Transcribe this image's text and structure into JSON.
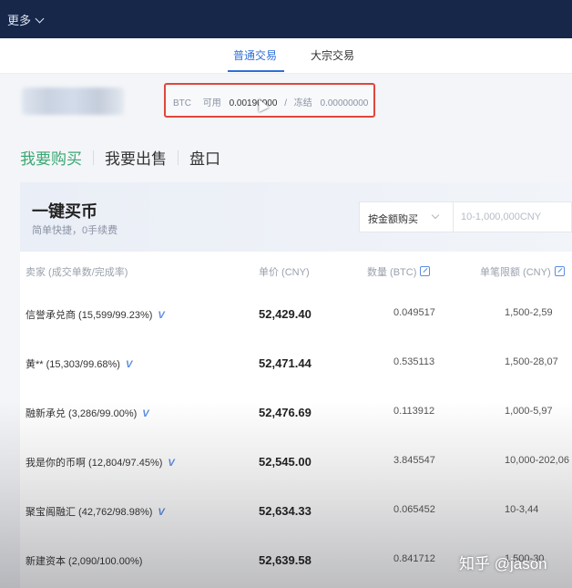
{
  "topbar": {
    "more_label": "更多"
  },
  "trade_tabs": [
    {
      "label": "普通交易",
      "active": true
    },
    {
      "label": "大宗交易",
      "active": false
    }
  ],
  "balance": {
    "coin": "BTC",
    "available_label": "可用",
    "available_value": "0.00190000",
    "separator": "/",
    "frozen_label": "冻结",
    "frozen_value": "0.00000000"
  },
  "mode_tabs": [
    {
      "label": "我要购买",
      "active": true
    },
    {
      "label": "我要出售",
      "active": false
    },
    {
      "label": "盘口",
      "active": false
    }
  ],
  "quick_buy": {
    "title": "一键买币",
    "subtitle": "简单快捷，0手续费",
    "select_value": "按金额购买",
    "input_placeholder": "10-1,000,000CNY"
  },
  "table": {
    "headers": {
      "merchant": "卖家 (成交单数/完成率)",
      "price": "单价 (CNY)",
      "qty": "数量 (BTC)",
      "limit": "单笔限额 (CNY)"
    },
    "rows": [
      {
        "merchant": "信誉承兑商 (15,599/99.23%)",
        "price": "52,429.40",
        "qty": "0.049517",
        "limit": "1,500-2,59"
      },
      {
        "merchant": "黄** (15,303/99.68%)",
        "price": "52,471.44",
        "qty": "0.535113",
        "limit": "1,500-28,07"
      },
      {
        "merchant": "融新承兑 (3,286/99.00%)",
        "price": "52,476.69",
        "qty": "0.113912",
        "limit": "1,000-5,97"
      },
      {
        "merchant": "我是你的币啊 (12,804/97.45%)",
        "price": "52,545.00",
        "qty": "3.845547",
        "limit": "10,000-202,06"
      },
      {
        "merchant": "聚宝阁融汇 (42,762/98.98%)",
        "price": "52,634.33",
        "qty": "0.065452",
        "limit": "10-3,44"
      },
      {
        "merchant": "新建资本 (2,090/100.00%)",
        "price": "52,639.58",
        "qty": "0.841712",
        "limit": "1,500-30"
      }
    ],
    "verified_badge": "V"
  },
  "watermark": "知乎 @jason",
  "colors": {
    "topbar": "#16274a",
    "active_tab": "#2f6fd8",
    "buy_active": "#3ba874",
    "highlight_box": "#e0463d"
  }
}
